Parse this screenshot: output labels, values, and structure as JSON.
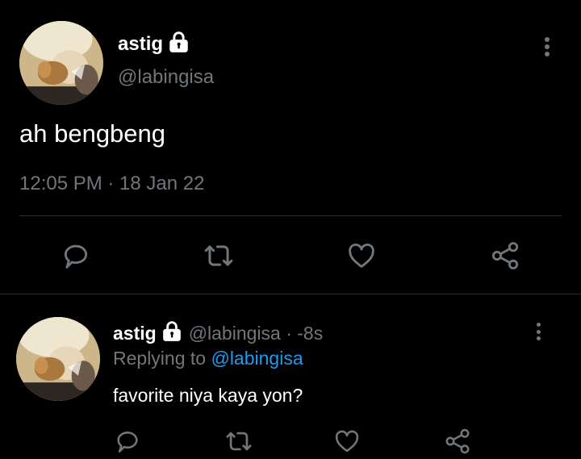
{
  "main_tweet": {
    "display_name": "astig",
    "handle": "@labingisa",
    "text": "ah bengbeng",
    "timestamp": "12:05 PM · 18 Jan 22"
  },
  "reply": {
    "display_name": "astig",
    "handle_time": "@labingisa · -8s",
    "replying_prefix": "Replying to",
    "replying_handle": "@labingisa",
    "text": "favorite niya kaya yon?"
  },
  "icons": {
    "lock": "lock-icon",
    "more": "more-vertical-icon",
    "reply": "reply-icon",
    "retweet": "retweet-icon",
    "like": "heart-icon",
    "share": "share-icon"
  },
  "colors": {
    "background": "#000000",
    "text": "#ffffff",
    "muted": "#71767b",
    "link": "#1d9bf0",
    "divider": "#2f3336"
  }
}
